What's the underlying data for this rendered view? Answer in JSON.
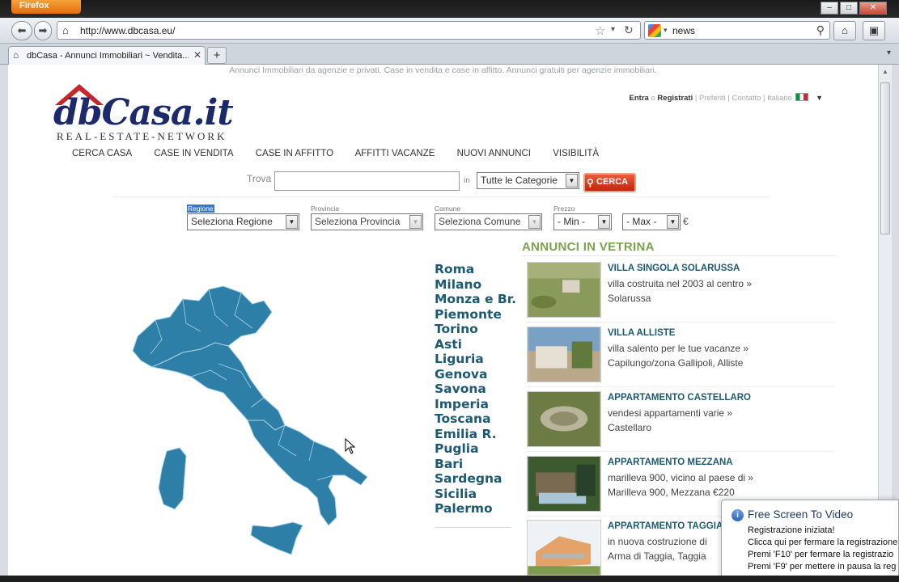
{
  "browser": {
    "app_button": "Firefox",
    "url": "http://www.dbcasa.eu/",
    "search_query": "news",
    "tab_title": "dbCasa - Annunci Immobiliari ~ Vendita..."
  },
  "site": {
    "tagline": "Annunci Immobiliari da agenzie e privati. Case in vendita e case in affitto. Annunci gratuiti per agenzie immobiliari.",
    "logo_text": "dbCasa.it",
    "logo_sub": "REAL-ESTATE-NETWORK",
    "top_links": {
      "entra": "Entra",
      "o": "o",
      "registrati": "Registrati",
      "preferiti": "Preferiti",
      "contatto": "Contatto",
      "lingua": "Italiano"
    },
    "nav": [
      "CERCA CASA",
      "CASE IN VENDITA",
      "CASE IN AFFITTO",
      "AFFITTI VACANZE",
      "NUOVI ANNUNCI",
      "VISIBILITÀ"
    ],
    "search": {
      "trova_label": "Trova",
      "in_label": "in",
      "category_value": "Tutte le Categorie",
      "button": "CERCA"
    },
    "filters": {
      "regione_label": "Regione",
      "regione_value": "Seleziona Regione",
      "provincia_label": "Provincia",
      "provincia_value": "Seleziona Provincia",
      "comune_label": "Comune",
      "comune_value": "Seleziona Comune",
      "prezzo_label": "Prezzo",
      "min_value": "- Min -",
      "max_value": "- Max -",
      "currency": "€"
    },
    "regions": [
      "Roma",
      "Milano",
      "Monza e Br.",
      "Piemonte",
      "Torino",
      "Asti",
      "Liguria",
      "Genova",
      "Savona",
      "Imperia",
      "Toscana",
      "Emilia R.",
      "Puglia",
      "Bari",
      "Sardegna",
      "Sicilia",
      "Palermo"
    ],
    "vetrina": {
      "title": "ANNUNCI IN VETRINA",
      "listings": [
        {
          "title": "VILLA SINGOLA SOLARUSSA",
          "desc": "villa costruita nel 2003 al centro »",
          "place": "Solarussa"
        },
        {
          "title": "VILLA ALLISTE",
          "desc": "villa salento per le tue vacanze »",
          "place": "Capilungo/zona Gallipoli, Alliste"
        },
        {
          "title": "APPARTAMENTO CASTELLARO",
          "desc": "vendesi appartamenti varie »",
          "place": "Castellaro"
        },
        {
          "title": "APPARTAMENTO MEZZANA",
          "desc": "marilleva 900, vicino al paese di »",
          "place": "Marilleva 900, Mezzana €220"
        },
        {
          "title": "APPARTAMENTO TAGGIA",
          "desc": "in nuova costruzione di",
          "place": "Arma di Taggia, Taggia"
        }
      ]
    }
  },
  "popup": {
    "title": "Free Screen To Video",
    "lines": [
      "Registrazione iniziata!",
      "Clicca qui per fermare la registrazione",
      "Premi 'F10' per fermare la registrazio",
      "Premi 'F9' per mettere in pausa la reg"
    ]
  },
  "colors": {
    "accent_blue": "#1d5a72",
    "map_blue": "#2e7fa8",
    "vetrina_green": "#7ba24c",
    "cerca_red": "#c3250d"
  }
}
